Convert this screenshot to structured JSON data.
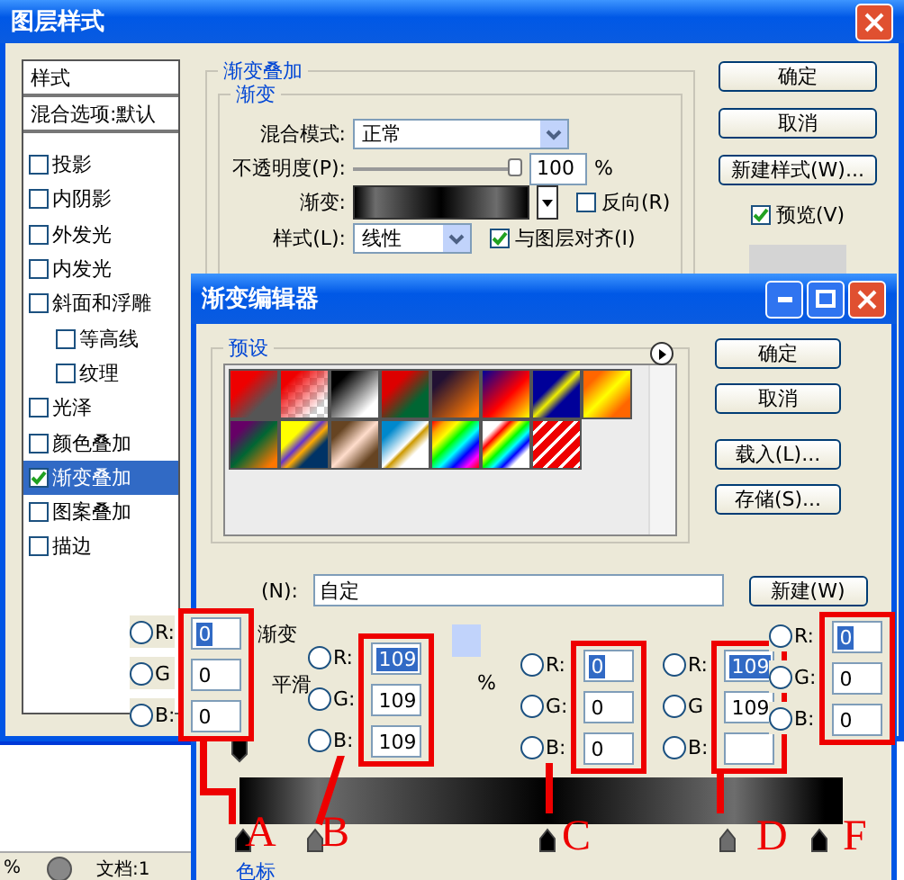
{
  "window": {
    "title": "图层样式"
  },
  "styles_panel": {
    "header": "样式",
    "blend_options": "混合选项:默认",
    "items": [
      {
        "label": "投影",
        "checked": false,
        "selected": false
      },
      {
        "label": "内阴影",
        "checked": false,
        "selected": false
      },
      {
        "label": "外发光",
        "checked": false,
        "selected": false
      },
      {
        "label": "内发光",
        "checked": false,
        "selected": false
      },
      {
        "label": "斜面和浮雕",
        "checked": false,
        "selected": false,
        "children": [
          {
            "label": "等高线",
            "checked": false,
            "selected": false
          },
          {
            "label": "纹理",
            "checked": false,
            "selected": false
          }
        ]
      },
      {
        "label": "光泽",
        "checked": false,
        "selected": false
      },
      {
        "label": "颜色叠加",
        "checked": false,
        "selected": false
      },
      {
        "label": "渐变叠加",
        "checked": true,
        "selected": true
      },
      {
        "label": "图案叠加",
        "checked": false,
        "selected": false
      },
      {
        "label": "描边",
        "checked": false,
        "selected": false
      }
    ]
  },
  "gradient_overlay": {
    "title": "渐变叠加",
    "group_title": "渐变",
    "blend_mode": {
      "label": "混合模式:",
      "value": "正常"
    },
    "opacity": {
      "label": "不透明度(P):",
      "level": 1,
      "value": "100",
      "unit": "%"
    },
    "gradient": {
      "label": "渐变:"
    },
    "reverse": {
      "label": "反向(R)",
      "checked": false
    },
    "style": {
      "label": "样式(L):",
      "value": "线性"
    },
    "align": {
      "label": "与图层对齐(I)",
      "checked": true
    }
  },
  "buttons": [
    "确定",
    "取消",
    "新建样式(W)..."
  ],
  "preview": {
    "label": "预览(V)",
    "checked": true
  },
  "status_bar": {
    "zoom": "%",
    "document": "文档:1"
  },
  "gradient_editor": {
    "title": "渐变编辑器",
    "presets_title": "预设",
    "buttons": [
      "确定",
      "取消",
      "载入(L)...",
      "存储(S)..."
    ],
    "name": {
      "label": "(N):",
      "value": "自定"
    },
    "new_button": "新建(W)",
    "type_label": "渐变",
    "smooth_label": "平滑",
    "smooth_unit": "%",
    "color_stops_title": "色标"
  },
  "callouts": [
    {
      "letter": "A",
      "fields": [
        {
          "label": "R:",
          "value": "0",
          "highlighted": true,
          "selected": false
        },
        {
          "label": "G",
          "value": "0",
          "highlighted": false,
          "selected": false
        },
        {
          "label": "B:",
          "value": "0",
          "highlighted": false,
          "selected": false
        }
      ]
    },
    {
      "letter": "B",
      "fields": [
        {
          "label": "R:",
          "value": "109",
          "highlighted": true,
          "selected": false
        },
        {
          "label": "G:",
          "value": "109",
          "highlighted": false,
          "selected": false
        },
        {
          "label": "B:",
          "value": "109",
          "highlighted": false,
          "selected": false
        }
      ]
    },
    {
      "letter": "C",
      "fields": [
        {
          "label": "R:",
          "value": "0",
          "highlighted": true,
          "selected": false
        },
        {
          "label": "G:",
          "value": "0",
          "highlighted": false,
          "selected": false
        },
        {
          "label": "B:",
          "value": "0",
          "highlighted": false,
          "selected": false
        }
      ]
    },
    {
      "letter": "D",
      "fields": [
        {
          "label": "R:",
          "value": "109",
          "highlighted": true,
          "selected": false
        },
        {
          "label": "G",
          "value": "109",
          "highlighted": false,
          "selected": false
        },
        {
          "label": "B:",
          "selected": false
        }
      ]
    },
    {
      "letter": "F",
      "fields": [
        {
          "label": "R:",
          "value": "0",
          "highlighted": true,
          "selected": false
        },
        {
          "label": "G:",
          "value": "0",
          "highlighted": false,
          "selected": false
        },
        {
          "label": "B:",
          "value": "0",
          "highlighted": false,
          "selected": false
        }
      ]
    }
  ]
}
